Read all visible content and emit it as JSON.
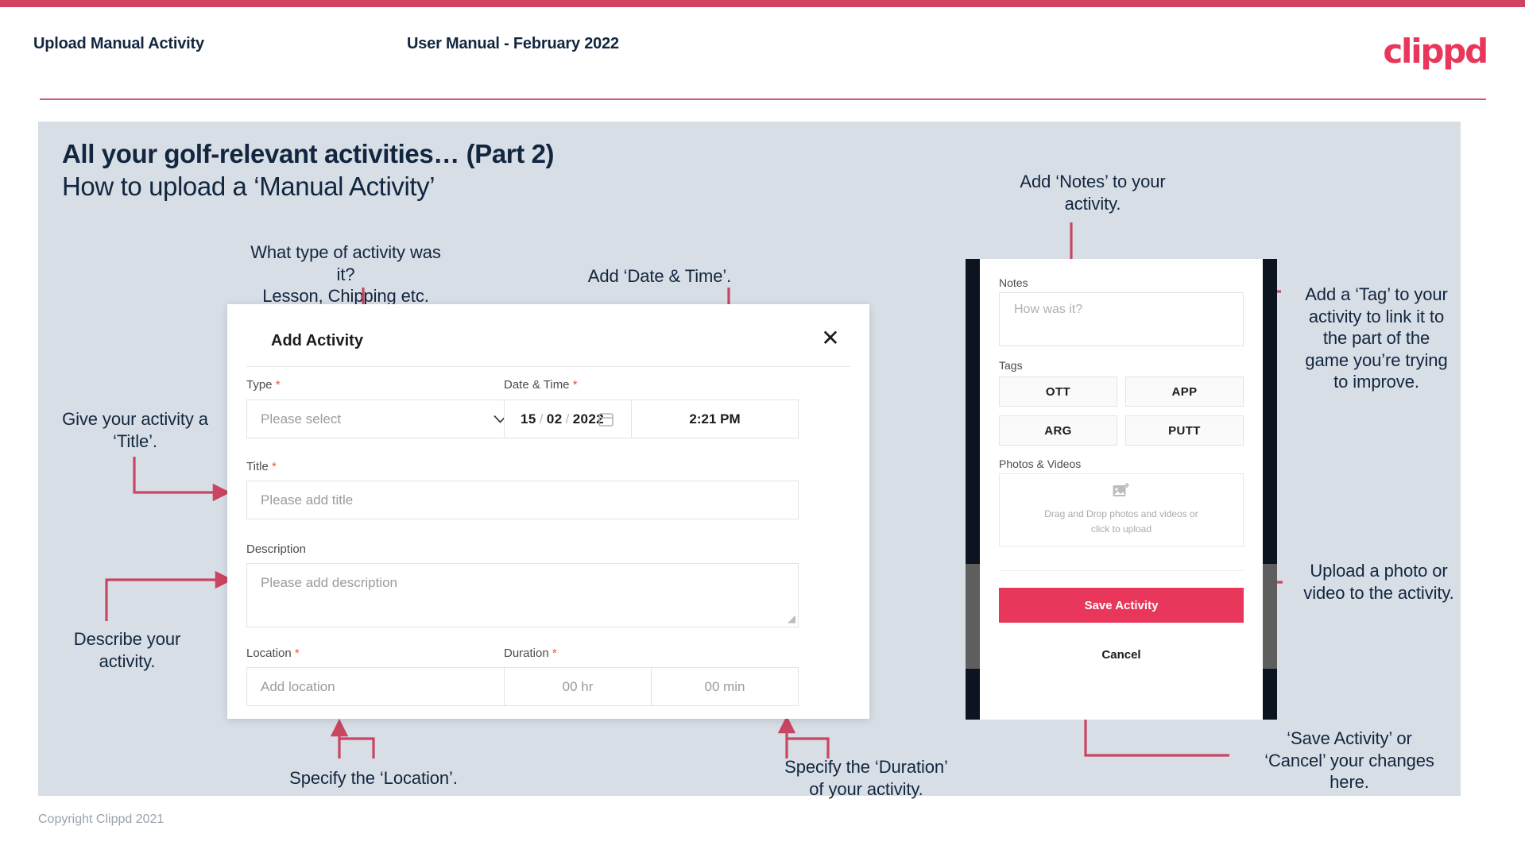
{
  "header": {
    "left_title": "Upload Manual Activity",
    "center_title": "User Manual - February 2022",
    "logo": "clippd"
  },
  "slide": {
    "title_line1": "All your golf-relevant activities… (Part 2)",
    "title_line2": "How to upload a ‘Manual Activity’"
  },
  "footer": {
    "copyright": "Copyright Clippd 2021"
  },
  "annotations": {
    "type": "What type of activity was it?\nLesson, Chipping etc.",
    "datetime": "Add ‘Date & Time’.",
    "title": "Give your activity a\n‘Title’.",
    "description": "Describe your\nactivity.",
    "location": "Specify the ‘Location’.",
    "duration": "Specify the ‘Duration’\nof your activity.",
    "notes": "Add ‘Notes’ to your\nactivity.",
    "tags": "Add a ‘Tag’ to your\nactivity to link it to\nthe part of the\ngame you’re trying\nto improve.",
    "upload": "Upload a photo or\nvideo to the activity.",
    "save_cancel": "‘Save Activity’ or\n‘Cancel’ your changes\nhere."
  },
  "dialog": {
    "title": "Add Activity",
    "close_icon": "close-icon",
    "fields": {
      "type": {
        "label": "Type",
        "required": "*",
        "placeholder": "Please select",
        "chevron_icon": "chevron-down-icon"
      },
      "datetime": {
        "label": "Date & Time",
        "required": "*",
        "day": "15",
        "sep1": "/",
        "month": "02",
        "sep2": "/",
        "year": "2022",
        "calendar_icon": "calendar-icon",
        "time": "2:21 PM"
      },
      "title": {
        "label": "Title",
        "required": "*",
        "placeholder": "Please add title"
      },
      "description": {
        "label": "Description",
        "required": "",
        "placeholder": "Please add description"
      },
      "location": {
        "label": "Location",
        "required": "*",
        "placeholder": "Add location"
      },
      "duration": {
        "label": "Duration",
        "required": "*",
        "hours_placeholder": "00 hr",
        "minutes_placeholder": "00 min"
      }
    }
  },
  "phone": {
    "notes_label": "Notes",
    "notes_placeholder": "How was it?",
    "tags_label": "Tags",
    "tags": [
      "OTT",
      "APP",
      "ARG",
      "PUTT"
    ],
    "photos_label": "Photos & Videos",
    "dropzone_icon": "add-image-icon",
    "dropzone_line1": "Drag and Drop photos and videos or",
    "dropzone_line2": "click to upload",
    "save_label": "Save Activity",
    "cancel_label": "Cancel"
  },
  "colors": {
    "brand_pink": "#e8375a",
    "accent_bar": "#cf4360",
    "arrow": "#c94562",
    "slide_bg": "#d8dee6",
    "text_dark": "#12263f"
  }
}
